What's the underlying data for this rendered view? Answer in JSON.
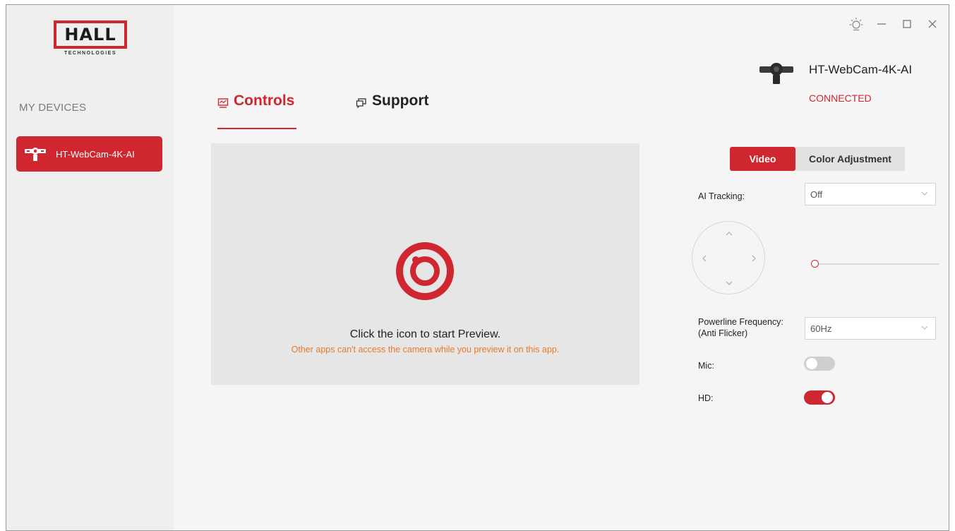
{
  "sidebar": {
    "logo_text": "HALL",
    "logo_subtext": "TECHNOLOGIES",
    "section_title": "MY DEVICES",
    "devices": [
      {
        "label": "HT-WebCam-4K-AI",
        "icon": "webcam-icon",
        "selected": true
      }
    ]
  },
  "window_controls": {
    "icons": [
      "brightness-icon",
      "minimize-icon",
      "maximize-icon",
      "close-icon"
    ]
  },
  "tabs": [
    {
      "label": "Controls",
      "icon": "controls-icon",
      "active": true
    },
    {
      "label": "Support",
      "icon": "support-icon",
      "active": false
    }
  ],
  "preview": {
    "icon": "preview-start-icon",
    "title": "Click the icon to start Preview.",
    "note": "Other apps can't access the camera while you preview it on this app."
  },
  "device_header": {
    "name": "HT-WebCam-4K-AI",
    "status": "CONNECTED"
  },
  "panel_tabs": {
    "video": "Video",
    "color": "Color Adjustment",
    "active": "Video"
  },
  "settings": {
    "ai_tracking": {
      "label": "AI Tracking:",
      "value": "Off"
    },
    "zoom": {
      "value": 0
    },
    "powerline": {
      "label_line1": "Powerline Frequency:",
      "label_line2": "(Anti Flicker)",
      "value": "60Hz"
    },
    "mic": {
      "label": "Mic:",
      "on": false
    },
    "hd": {
      "label": "HD:",
      "on": true
    }
  },
  "colors": {
    "accent": "#d0262f",
    "note": "#e87b2c",
    "sidebar_bg": "#efefef",
    "preview_bg": "#e6e6e6"
  }
}
